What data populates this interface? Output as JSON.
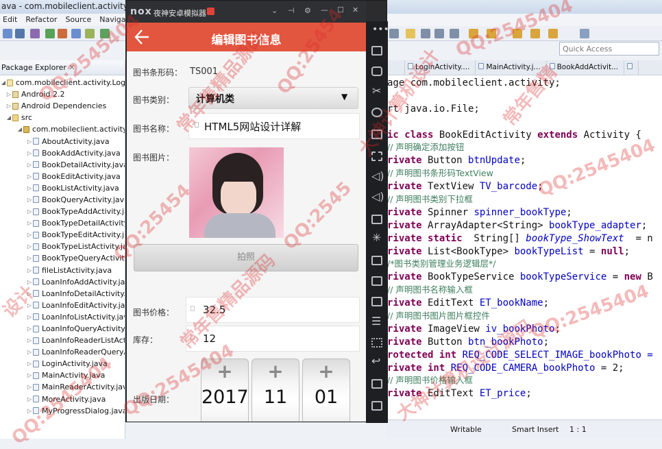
{
  "eclipse": {
    "title": "ava - com.mobileclient.activity.LoginAct",
    "menu": [
      "Edit",
      "Refactor",
      "Source",
      "Navigate"
    ],
    "quick_access": "Quick Access",
    "package_explorer": {
      "title": "Package Explorer",
      "project": "com.mobileclient.activity.LoginAc",
      "lib1": "Android 2.2",
      "lib2": "Android Dependencies",
      "src": "src",
      "package": "com.mobileclient.activity",
      "files": [
        "AboutActivity.java",
        "BookAddActivity.java",
        "BookDetailActivity.java",
        "BookEditActivity.java",
        "BookListActivity.java",
        "BookQueryActivity.java",
        "BookTypeAddActivity.java",
        "BookTypeDetailActivity.java",
        "BookTypeEditActivity.java",
        "BookTypeListActivity.java",
        "BookTypeQueryActivity.java",
        "fileListActivity.java",
        "LoanInfoAddActivity.java",
        "LoanInfoDetailActivity.java",
        "LoanInfoEditActivity.java",
        "LoanInfoListActivity.java",
        "LoanInfoQueryActivity.java",
        "LoanInfoReaderListActivity.java",
        "LoanInfoReaderQueryActivity.java",
        "LoginActivity.java",
        "MainActivity.java",
        "MainReaderActivity.java",
        "MoreActivity.java",
        "MyProgressDialog.java"
      ]
    },
    "editor_tabs": [
      "LoginActivity....",
      "MainActivity.j...",
      "BookAddActivit..."
    ],
    "code": [
      {
        "cls": "",
        "parts": [
          {
            "t": "age com.mobileclient.activity;",
            "k": ""
          }
        ]
      },
      {
        "cls": "",
        "parts": []
      },
      {
        "cls": "",
        "parts": [
          {
            "t": "rt java.io.File;",
            "k": ""
          }
        ]
      },
      {
        "cls": "",
        "parts": []
      },
      {
        "cls": "",
        "parts": [
          {
            "t": "ic class",
            "k": "kw"
          },
          {
            "t": " BookEditActivity ",
            "k": ""
          },
          {
            "t": "extends",
            "k": "kw"
          },
          {
            "t": " Activity {",
            "k": ""
          }
        ]
      },
      {
        "cls": "cm",
        "parts": [
          {
            "t": "// 声明确定添加按钮",
            "k": ""
          }
        ]
      },
      {
        "cls": "",
        "parts": [
          {
            "t": "rivate",
            "k": "kw"
          },
          {
            "t": " Button ",
            "k": ""
          },
          {
            "t": "btnUpdate",
            "k": "fld"
          },
          {
            "t": ";",
            "k": ""
          }
        ]
      },
      {
        "cls": "cm",
        "parts": [
          {
            "t": "// 声明图书条形码TextView",
            "k": ""
          }
        ]
      },
      {
        "cls": "",
        "parts": [
          {
            "t": "rivate",
            "k": "kw"
          },
          {
            "t": " TextView ",
            "k": ""
          },
          {
            "t": "TV_barcode",
            "k": "fld"
          },
          {
            "t": ";",
            "k": ""
          }
        ]
      },
      {
        "cls": "cm",
        "parts": [
          {
            "t": "// 声明图书类别下拉框",
            "k": ""
          }
        ]
      },
      {
        "cls": "",
        "parts": [
          {
            "t": "rivate",
            "k": "kw"
          },
          {
            "t": " Spinner ",
            "k": ""
          },
          {
            "t": "spinner_bookType",
            "k": "fld"
          },
          {
            "t": ";",
            "k": ""
          }
        ]
      },
      {
        "cls": "",
        "parts": [
          {
            "t": "rivate",
            "k": "kw"
          },
          {
            "t": " ArrayAdapter<String> ",
            "k": ""
          },
          {
            "t": "bookType_adapter",
            "k": "fld"
          },
          {
            "t": ";",
            "k": ""
          }
        ]
      },
      {
        "cls": "",
        "parts": [
          {
            "t": "rivate static",
            "k": "kw"
          },
          {
            "t": "  String[] ",
            "k": ""
          },
          {
            "t": "bookType_ShowText",
            "k": "it"
          },
          {
            "t": "  = n",
            "k": ""
          }
        ]
      },
      {
        "cls": "",
        "parts": [
          {
            "t": "rivate",
            "k": "kw"
          },
          {
            "t": " List<BookType> ",
            "k": ""
          },
          {
            "t": "bookTypeList",
            "k": "fld"
          },
          {
            "t": " = ",
            "k": ""
          },
          {
            "t": "null",
            "k": "kw"
          },
          {
            "t": ";",
            "k": ""
          }
        ]
      },
      {
        "cls": "cm",
        "parts": [
          {
            "t": "/*图书类别管理业务逻辑层*/",
            "k": ""
          }
        ]
      },
      {
        "cls": "",
        "parts": [
          {
            "t": "rivate",
            "k": "kw"
          },
          {
            "t": " BookTypeService ",
            "k": ""
          },
          {
            "t": "bookTypeService",
            "k": "fld"
          },
          {
            "t": " = ",
            "k": ""
          },
          {
            "t": "new",
            "k": "kw"
          },
          {
            "t": " B",
            "k": ""
          }
        ]
      },
      {
        "cls": "cm",
        "parts": [
          {
            "t": "// 声明图书名称输入框",
            "k": ""
          }
        ]
      },
      {
        "cls": "",
        "parts": [
          {
            "t": "rivate",
            "k": "kw"
          },
          {
            "t": " EditText ",
            "k": ""
          },
          {
            "t": "ET_bookName",
            "k": "fld"
          },
          {
            "t": ";",
            "k": ""
          }
        ]
      },
      {
        "cls": "cm",
        "parts": [
          {
            "t": "// 声明图书图片图片框控件",
            "k": ""
          }
        ]
      },
      {
        "cls": "",
        "parts": [
          {
            "t": "rivate",
            "k": "kw"
          },
          {
            "t": " ImageView ",
            "k": ""
          },
          {
            "t": "iv_bookPhoto",
            "k": "fld"
          },
          {
            "t": ";",
            "k": ""
          }
        ]
      },
      {
        "cls": "",
        "parts": [
          {
            "t": "rivate",
            "k": "kw"
          },
          {
            "t": " Button ",
            "k": ""
          },
          {
            "t": "btn_bookPhoto",
            "k": "fld"
          },
          {
            "t": ";",
            "k": ""
          }
        ]
      },
      {
        "cls": "",
        "parts": [
          {
            "t": "rotected int",
            "k": "kw"
          },
          {
            "t": " REQ_CODE_SELECT_IMAGE_bookPhoto =",
            "k": "fld"
          }
        ]
      },
      {
        "cls": "",
        "parts": [
          {
            "t": "rivate int",
            "k": "kw"
          },
          {
            "t": " REQ_CODE_CAMERA_bookPhoto",
            "k": "fld"
          },
          {
            "t": " = 2;",
            "k": ""
          }
        ]
      },
      {
        "cls": "cm",
        "parts": [
          {
            "t": "// 声明图书价格输入框",
            "k": ""
          }
        ]
      },
      {
        "cls": "",
        "parts": [
          {
            "t": "rivate",
            "k": "kw"
          },
          {
            "t": " EditText ",
            "k": ""
          },
          {
            "t": "ET_price",
            "k": "fld"
          },
          {
            "t": ";",
            "k": ""
          }
        ]
      }
    ],
    "status": {
      "writable": "Writable",
      "insert": "Smart Insert",
      "pos": "1 : 1"
    }
  },
  "emulator": {
    "logo": "nox",
    "title": "夜神安卓模拟器",
    "app_title": "编辑图书信息",
    "barcode_label": "图书条形码：",
    "barcode_value": "TS001",
    "category_label": "图书类别：",
    "category_value": "计算机类",
    "name_label": "图书名称：",
    "name_value": "HTML5网站设计详解",
    "photo_label": "图书图片：",
    "photo_button": "拍照",
    "price_label": "图书价格：",
    "price_value": "32.5",
    "stock_label": "库存：",
    "stock_value": "12",
    "date_label": "出版日期：",
    "year": "2017",
    "month": "11",
    "day": "01",
    "plus": "+",
    "minus": "−"
  },
  "watermarks": [
    "QQ:2545404",
    "QQ:2545404",
    "QQ:25454",
    "QQ:2545404",
    "QQ:2545",
    "QQ:25454",
    "QQ:2545404",
    "常年售精品源码",
    "大神计算机设计",
    "常年售精品源码",
    "QQ:2545404",
    "设计",
    "常年售精",
    "QQ:2545404",
    "大神计算机设计源码"
  ]
}
